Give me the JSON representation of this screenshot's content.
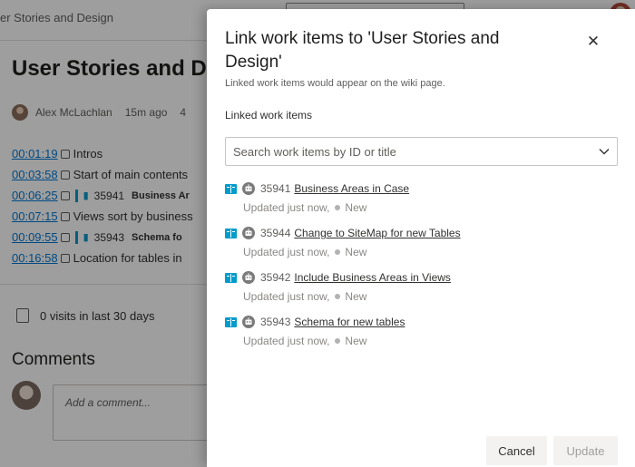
{
  "background": {
    "breadcrumb": "er Stories and Design",
    "page_title": "User Stories and D",
    "author": "Alex McLachlan",
    "edited": "15m ago",
    "revisions": "4",
    "lines": [
      {
        "time": "00:01:19",
        "text": "Intros"
      },
      {
        "time": "00:03:58",
        "text": "Start of main contents"
      },
      {
        "time": "00:06:25",
        "chip_id": "35941",
        "chip_title": "Business Ar"
      },
      {
        "time": "00:07:15",
        "text": "Views sort by business"
      },
      {
        "time": "00:09:55",
        "chip_id": "35943",
        "chip_title": "Schema fo"
      },
      {
        "time": "00:16:58",
        "text": "Location for tables in"
      }
    ],
    "visits": "0 visits in last 30 days",
    "comments_heading": "Comments",
    "comment_placeholder": "Add a comment..."
  },
  "dialog": {
    "title": "Link work items to 'User Stories and Design'",
    "subtitle": "Linked work items would appear on the wiki page.",
    "linked_label": "Linked work items",
    "search_placeholder": "Search work items by ID or title",
    "items": [
      {
        "id": "35941",
        "title": "Business Areas in Case",
        "updated": "Updated just now,",
        "state": "New"
      },
      {
        "id": "35944",
        "title": "Change to SiteMap for new Tables",
        "updated": "Updated just now,",
        "state": "New"
      },
      {
        "id": "35942",
        "title": "Include Business Areas in Views",
        "updated": "Updated just now,",
        "state": "New"
      },
      {
        "id": "35943",
        "title": "Schema for new tables",
        "updated": "Updated just now,",
        "state": "New"
      }
    ],
    "cancel_label": "Cancel",
    "update_label": "Update"
  },
  "colors": {
    "accent": "#0078d4",
    "work_item_type": "#009ccc",
    "state_dot": "#b2b2b2"
  }
}
